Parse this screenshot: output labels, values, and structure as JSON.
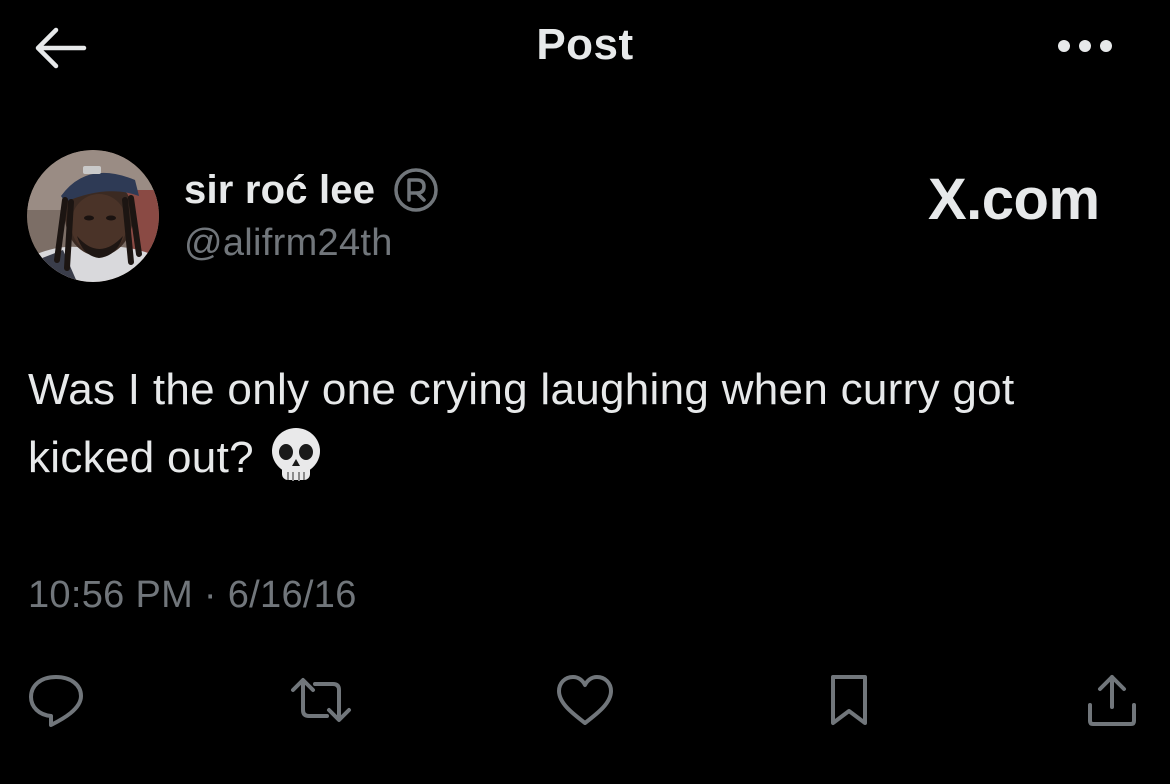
{
  "header": {
    "title": "Post",
    "back_icon": "arrow-left-icon",
    "more_icon": "more-horizontal-icon"
  },
  "author": {
    "display_name": "sir roć lee",
    "badge_icon": "registered-icon",
    "handle": "@alifrm24th"
  },
  "watermark": {
    "text": "X.com"
  },
  "post": {
    "text": "Was I the only one crying laughing when curry got kicked out?",
    "emoji_icon": "skull-emoji-icon"
  },
  "meta": {
    "time": "10:56 PM",
    "separator": "·",
    "date": "6/16/16"
  },
  "actions": [
    {
      "name": "reply",
      "icon": "reply-bubble-icon"
    },
    {
      "name": "repost",
      "icon": "repost-icon"
    },
    {
      "name": "like",
      "icon": "heart-icon"
    },
    {
      "name": "bookmark",
      "icon": "bookmark-icon"
    },
    {
      "name": "share",
      "icon": "share-icon"
    }
  ],
  "colors": {
    "background": "#000000",
    "text_primary": "#e7e9ea",
    "text_secondary": "#71767b"
  }
}
